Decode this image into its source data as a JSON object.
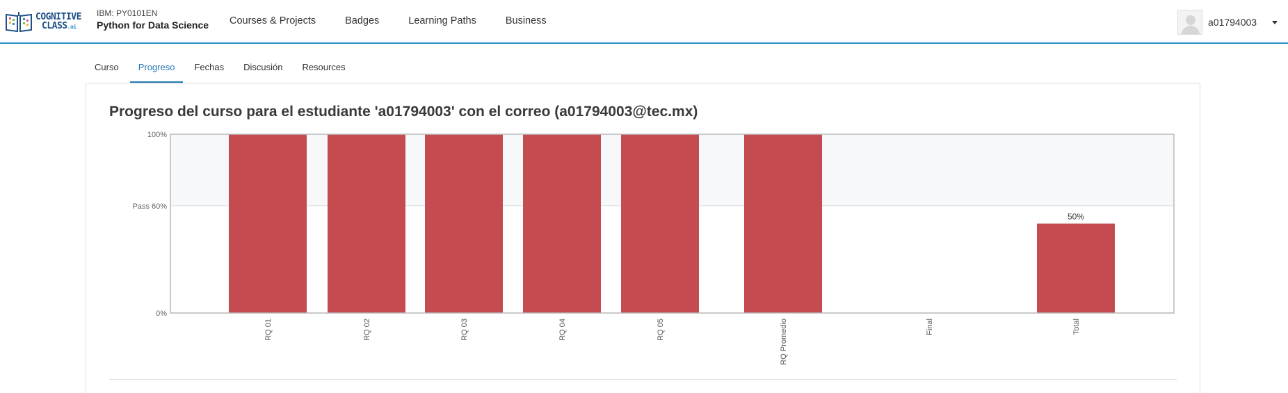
{
  "header": {
    "logo": {
      "line1": "COGNITIVE",
      "line2": "CLASS",
      "suffix": ".ai"
    },
    "course_id": "IBM: PY0101EN",
    "course_name": "Python for Data Science",
    "nav": [
      {
        "label": "Courses & Projects"
      },
      {
        "label": "Badges"
      },
      {
        "label": "Learning Paths"
      },
      {
        "label": "Business"
      }
    ],
    "user": {
      "name": "a01794003",
      "avatar_icon": "user-avatar-icon",
      "menu_icon": "caret-down-icon"
    },
    "accent_color": "#2f8fc9"
  },
  "tabs": [
    {
      "label": "Curso",
      "active": false
    },
    {
      "label": "Progreso",
      "active": true
    },
    {
      "label": "Fechas",
      "active": false
    },
    {
      "label": "Discusión",
      "active": false
    },
    {
      "label": "Resources",
      "active": false
    }
  ],
  "page_title": "Progreso del curso para el estudiante 'a01794003' con el correo (a01794003@tec.mx)",
  "chart_data": {
    "type": "bar",
    "categories": [
      "RQ 01",
      "RQ 02",
      "RQ 03",
      "RQ 04",
      "RQ 05",
      "RQ Promedio",
      "Final",
      "Total"
    ],
    "values": [
      100,
      100,
      100,
      100,
      100,
      100,
      0,
      50
    ],
    "data_labels": {
      "Total": "50%"
    },
    "ylim": [
      0,
      100
    ],
    "y_ticks": [
      {
        "value": 100,
        "label": "100%"
      },
      {
        "value": 60,
        "label": "Pass 60%"
      },
      {
        "value": 0,
        "label": "0%"
      }
    ],
    "pass_threshold": 60,
    "bar_color": "#c44b4f",
    "pass_band_color": "#f7f8fa",
    "x_tick_rotation": "vertical"
  }
}
